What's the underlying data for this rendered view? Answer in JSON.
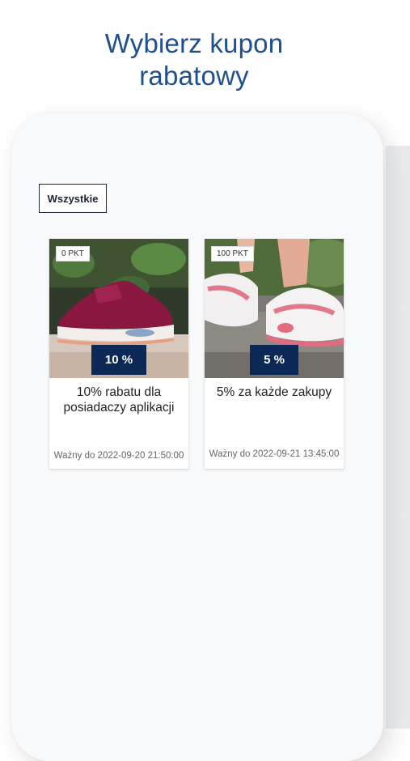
{
  "headline": {
    "line1": "Wybierz kupon",
    "line2": "rabatowy"
  },
  "filter": {
    "label": "Wszystkie"
  },
  "coupons": [
    {
      "points": "0 PKT",
      "discount": "10 %",
      "title": "10% rabatu dla posiadaczy aplikacji",
      "valid": "Ważny do 2022-09-20 21:50:00",
      "image": "burgundy-sneaker"
    },
    {
      "points": "100 PKT",
      "discount": "5 %",
      "title": "5% za każde zakupy",
      "valid": "Ważny do 2022-09-21 13:45:00",
      "image": "white-pink-sneakers"
    }
  ],
  "colors": {
    "headline": "#1f4f8e",
    "badge": "#0c2854"
  }
}
